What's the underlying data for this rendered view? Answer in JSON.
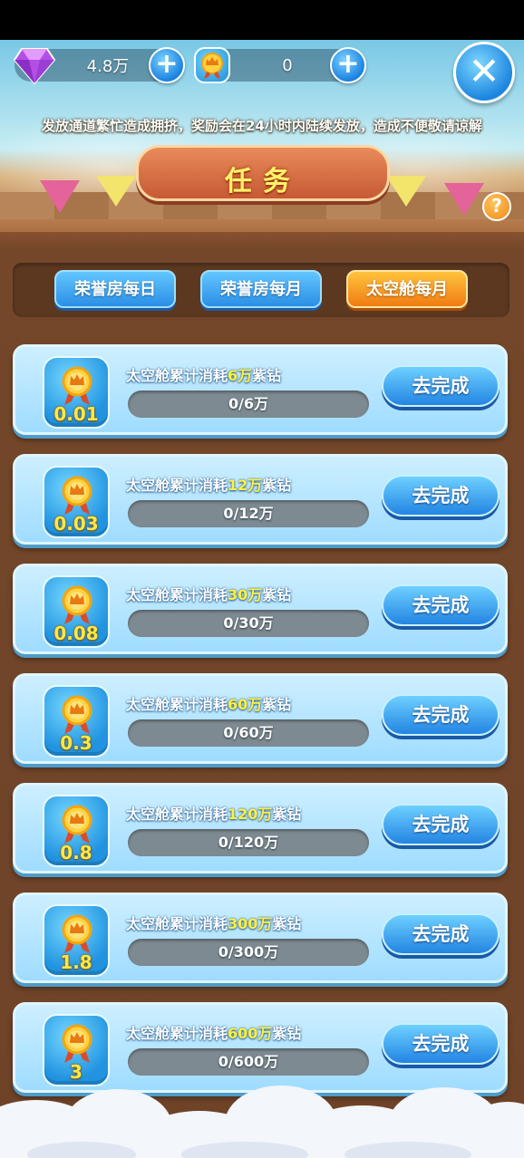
{
  "topbar": {
    "gem_amount": "4.8万",
    "coin_amount": "0",
    "plus_label": "+",
    "close_label": "✕"
  },
  "notice": "发放通道繁忙造成拥挤，奖励会在24小时内陆续发放，造成不便敬请谅解",
  "title": "任务",
  "help_label": "?",
  "tabs": [
    {
      "label": "荣誉房每日",
      "active": false
    },
    {
      "label": "荣誉房每月",
      "active": false
    },
    {
      "label": "太空舱每月",
      "active": true
    }
  ],
  "tasks": [
    {
      "prefix": "太空舱累计消耗",
      "amount": "6万",
      "suffix": "紫钻",
      "progress": "0/6万",
      "reward": "0.01",
      "button": "去完成"
    },
    {
      "prefix": "太空舱累计消耗",
      "amount": "12万",
      "suffix": "紫钻",
      "progress": "0/12万",
      "reward": "0.03",
      "button": "去完成"
    },
    {
      "prefix": "太空舱累计消耗",
      "amount": "30万",
      "suffix": "紫钻",
      "progress": "0/30万",
      "reward": "0.08",
      "button": "去完成"
    },
    {
      "prefix": "太空舱累计消耗",
      "amount": "60万",
      "suffix": "紫钻",
      "progress": "0/60万",
      "reward": "0.3",
      "button": "去完成"
    },
    {
      "prefix": "太空舱累计消耗",
      "amount": "120万",
      "suffix": "紫钻",
      "progress": "0/120万",
      "reward": "0.8",
      "button": "去完成"
    },
    {
      "prefix": "太空舱累计消耗",
      "amount": "300万",
      "suffix": "紫钻",
      "progress": "0/300万",
      "reward": "1.8",
      "button": "去完成"
    },
    {
      "prefix": "太空舱累计消耗",
      "amount": "600万",
      "suffix": "紫钻",
      "progress": "0/600万",
      "reward": "3",
      "button": "去完成"
    }
  ],
  "icons": {
    "gem": "purple-diamond-icon",
    "medal": "crown-medal-icon",
    "close": "close-icon",
    "help": "question-icon"
  },
  "colors": {
    "accent_blue": "#2385e2",
    "active_tab": "#f07c12",
    "highlight_yellow": "#fff23d",
    "wood": "#6f4226"
  }
}
